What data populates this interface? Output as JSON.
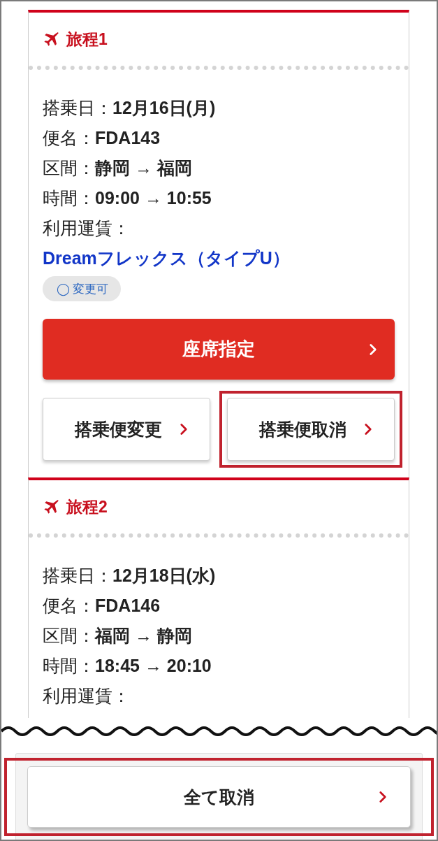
{
  "itineraries": [
    {
      "title": "旅程1",
      "details": [
        "搭乗日：**12月16日(月)**",
        "便名：**FDA143**",
        "区間：**静岡 → 福岡**",
        "時間：**09:00 → 10:55**",
        "利用運賃："
      ],
      "fare": "Dreamフレックス（タイプU）",
      "badge": {
        "symbol": "◯",
        "label": "変更可"
      },
      "actions": [
        {
          "label": "座席指定",
          "kind": "primary",
          "highlighted": false
        },
        {
          "label": "搭乗便変更",
          "kind": "secondary",
          "highlighted": false
        },
        {
          "label": "搭乗便取消",
          "kind": "secondary",
          "highlighted": true
        }
      ]
    },
    {
      "title": "旅程2",
      "details": [
        "搭乗日：**12月18日(水)**",
        "便名：**FDA146**",
        "区間：**福岡 → 静岡**",
        "時間：**18:45 → 20:10**",
        "利用運賃："
      ]
    }
  ],
  "footer_button": {
    "label": "全て取消",
    "highlighted": true
  }
}
